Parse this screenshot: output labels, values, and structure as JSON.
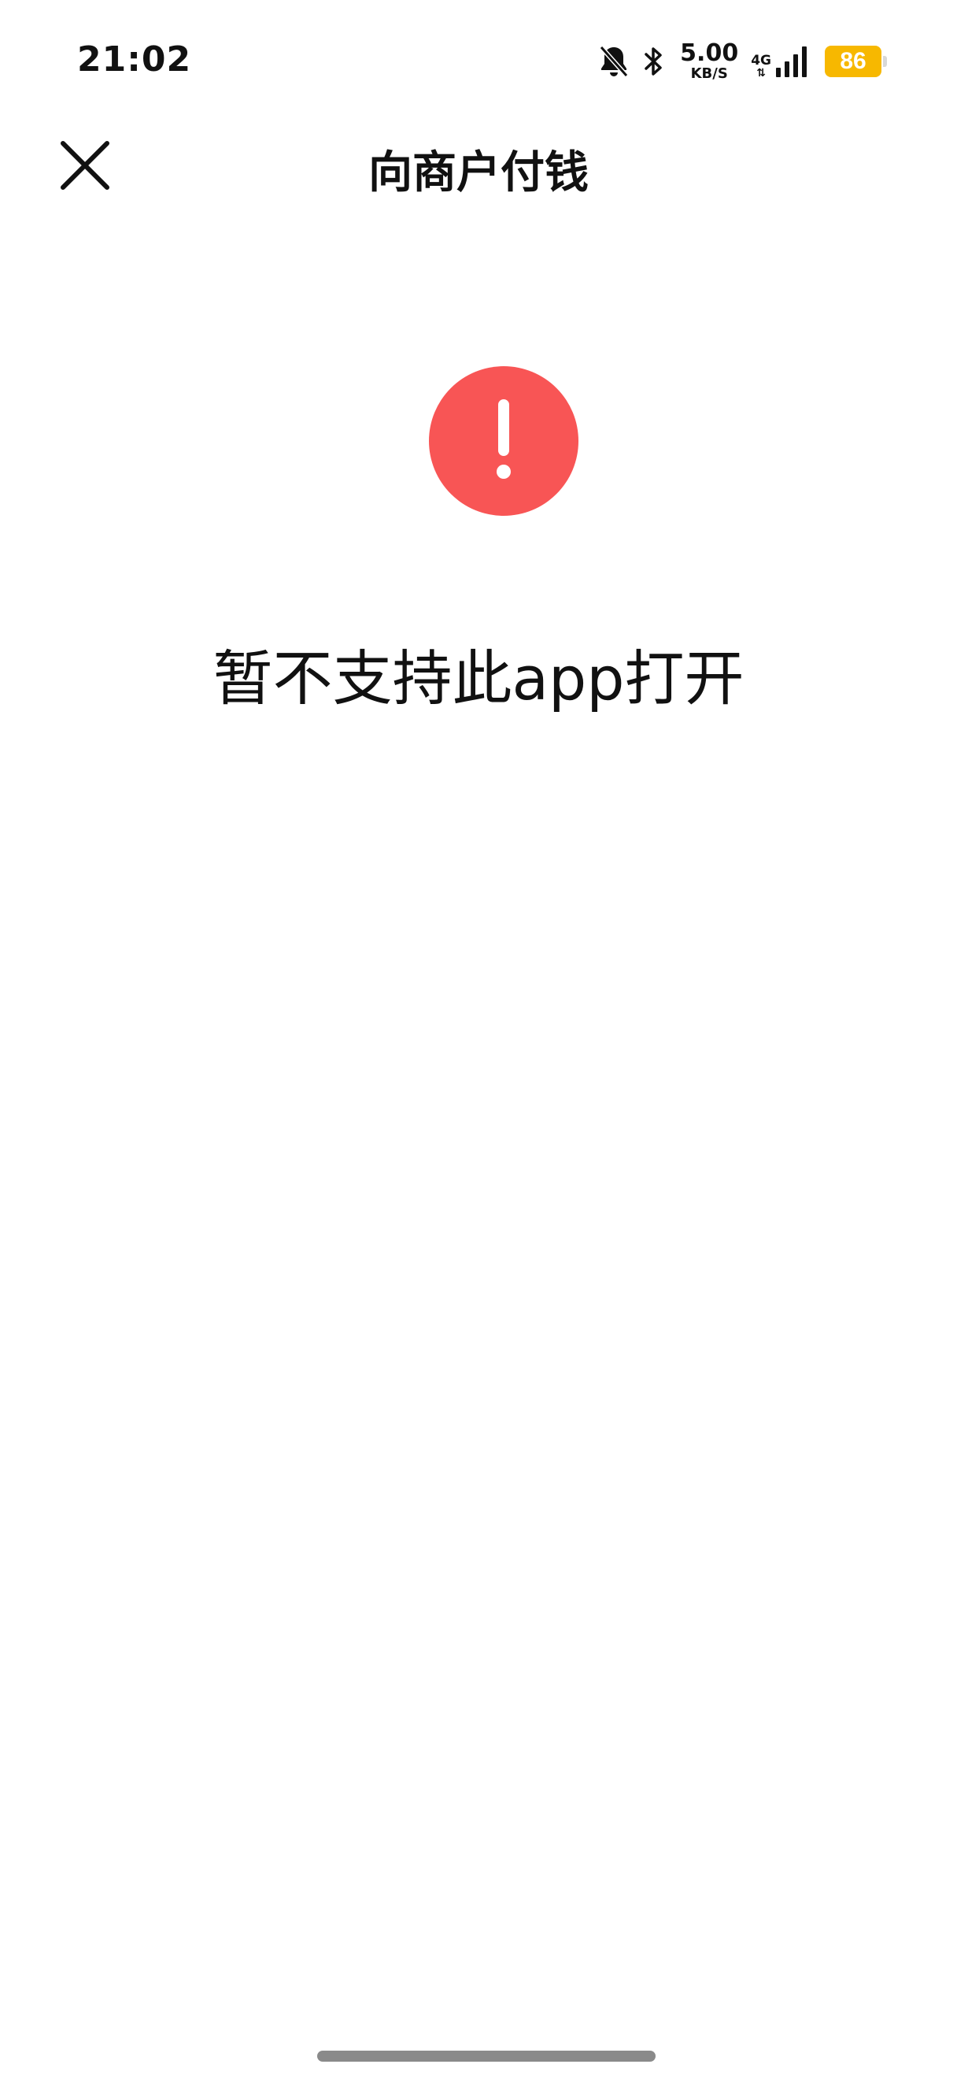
{
  "status_bar": {
    "time": "21:02",
    "icons": {
      "mute": "bell-off-icon",
      "bluetooth": "bluetooth-icon",
      "signal": "cellular-signal-icon"
    },
    "net_speed_value": "5.00",
    "net_speed_unit": "KB/S",
    "network_type": "4G",
    "network_arrows": "⇅",
    "battery_level": "86",
    "battery_color": "#f7b800"
  },
  "nav": {
    "title": "向商户付钱",
    "close_icon": "close-icon"
  },
  "error": {
    "icon": "exclamation-icon",
    "icon_color": "#f85555",
    "message": "暂不支持此app打开"
  }
}
